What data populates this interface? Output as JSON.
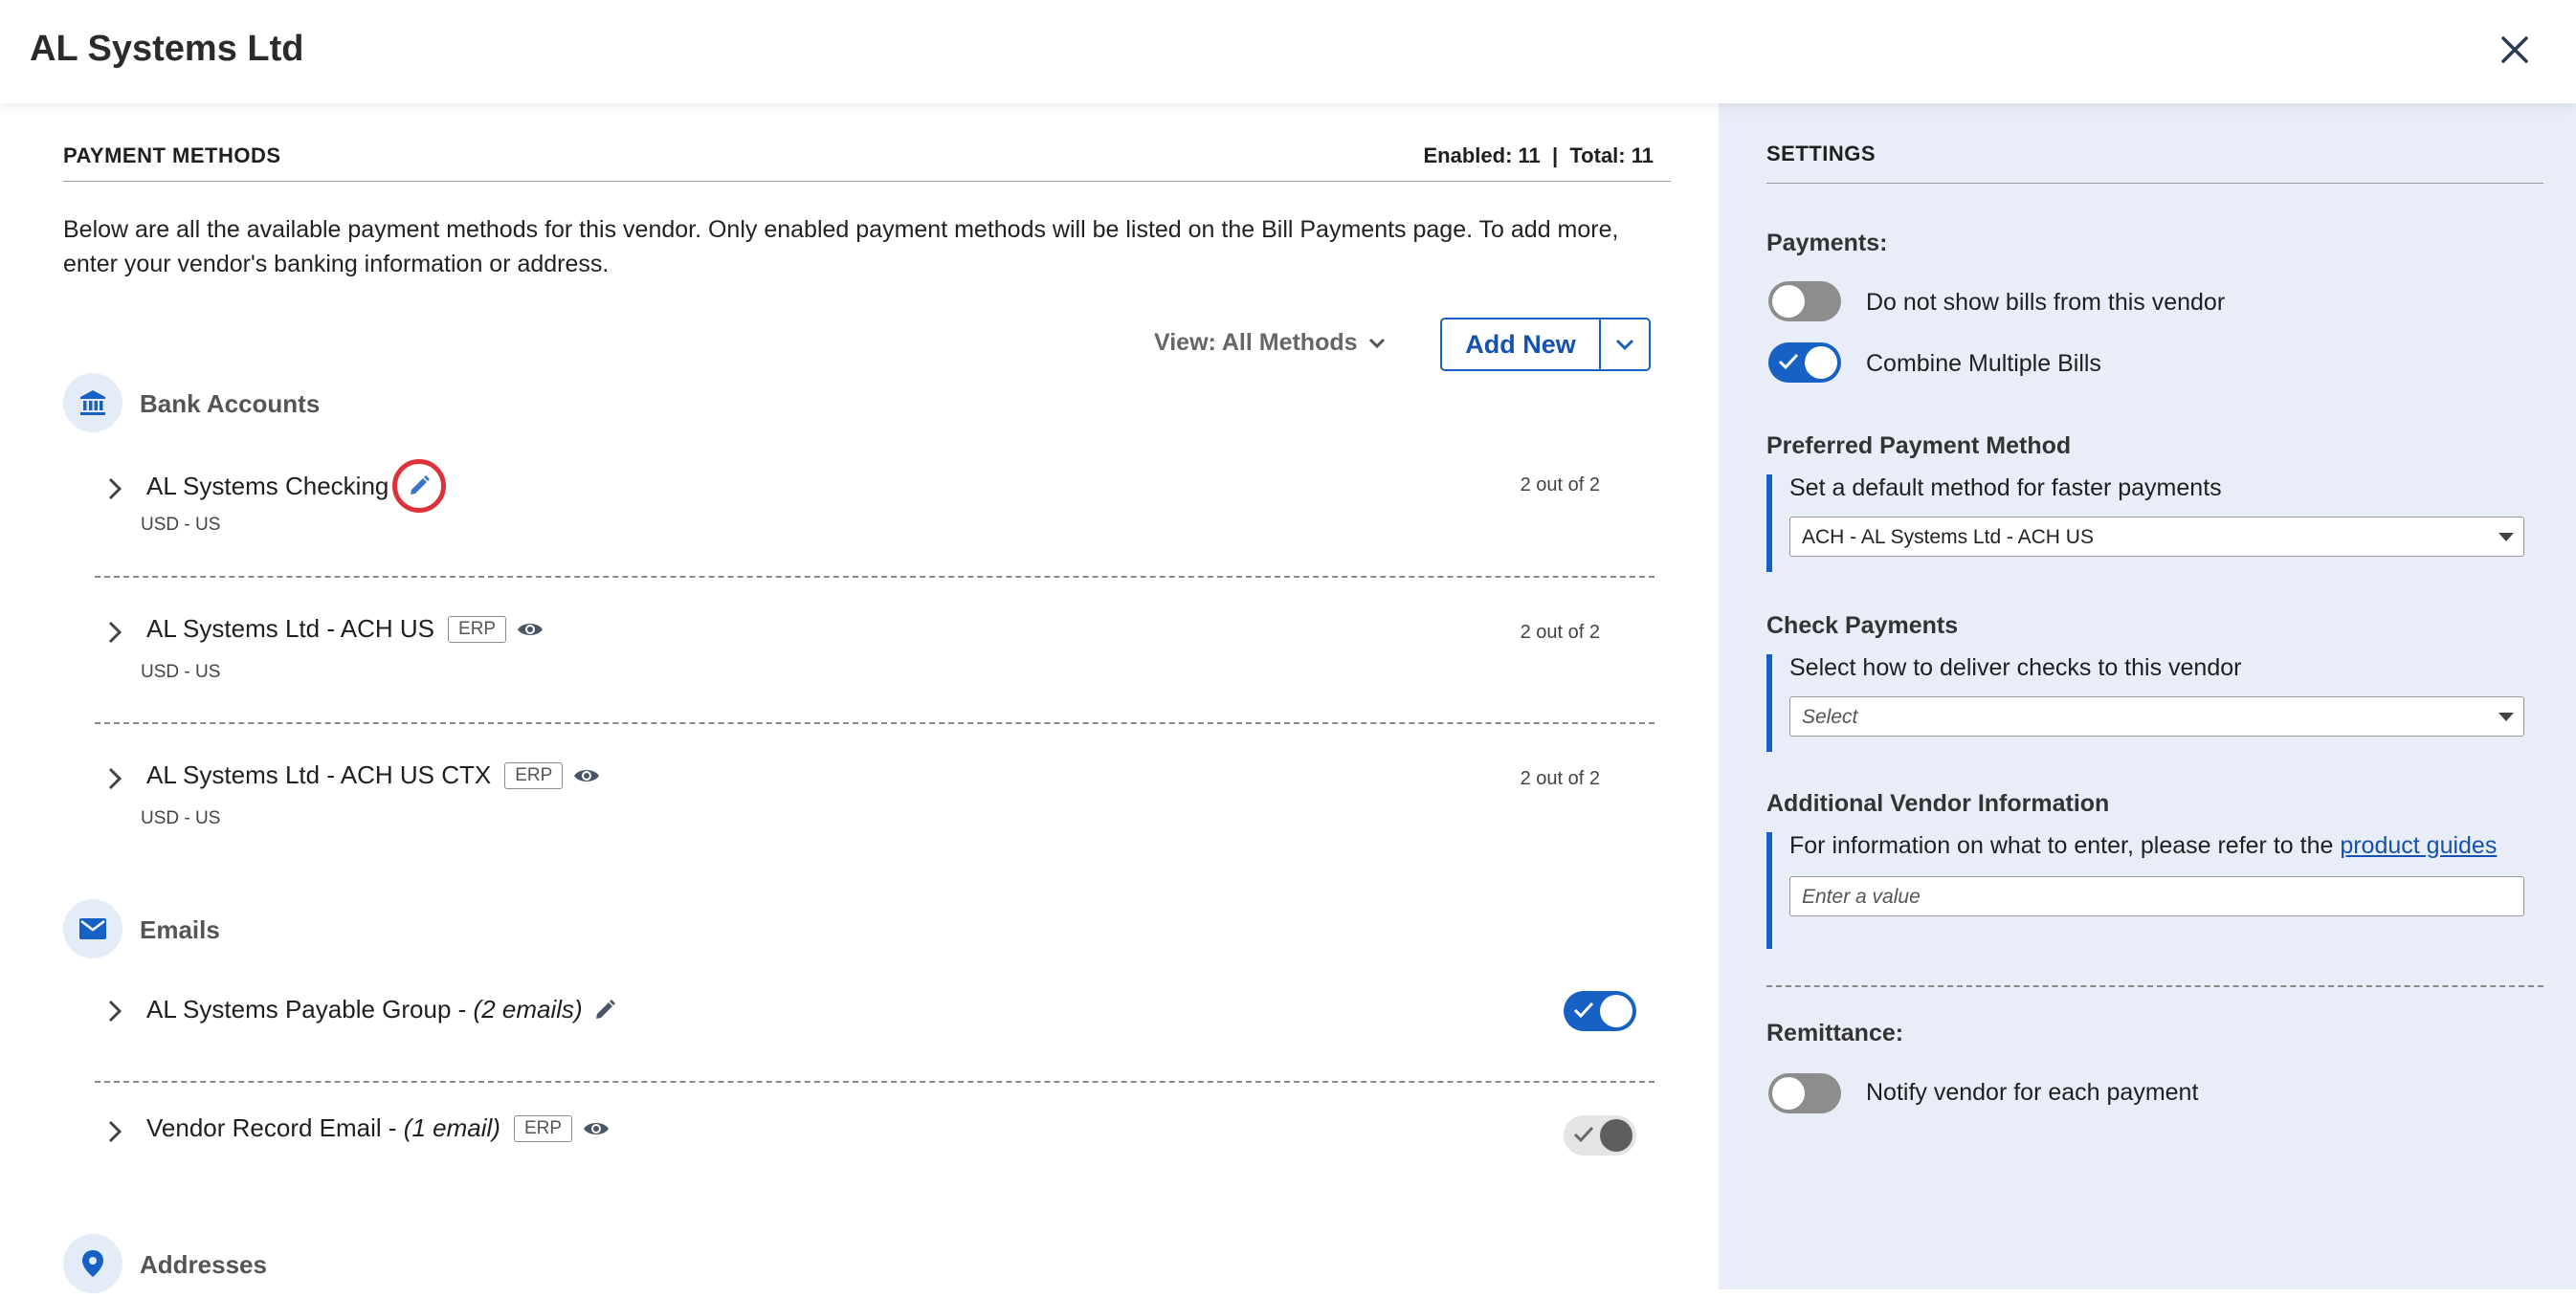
{
  "header": {
    "title": "AL Systems Ltd"
  },
  "payment_methods": {
    "title": "PAYMENT METHODS",
    "counts": "Enabled: 11  |  Total: 11",
    "intro": "Below are all the available payment methods for this vendor. Only enabled payment methods will be listed on the Bill Payments page. To add more, enter your vendor's banking information or address.",
    "view_label": "View: All Methods",
    "add_new_label": "Add New",
    "bank_accounts": {
      "label": "Bank Accounts",
      "items": [
        {
          "name": "AL Systems Checking",
          "sub": "USD - US",
          "count": "2 out of 2"
        },
        {
          "name": "AL Systems Ltd - ACH US",
          "erp": "ERP",
          "sub": "USD - US",
          "count": "2 out of 2"
        },
        {
          "name": "AL Systems Ltd - ACH US CTX",
          "erp": "ERP",
          "sub": "USD - US",
          "count": "2 out of 2"
        }
      ]
    },
    "emails": {
      "label": "Emails",
      "items": [
        {
          "name": "AL Systems Payable Group - ",
          "count_text": "(2 emails)",
          "enabled": true
        },
        {
          "name": "Vendor Record Email - ",
          "count_text": "(1 email)",
          "erp": "ERP",
          "enabled": true
        }
      ]
    },
    "addresses": {
      "label": "Addresses"
    }
  },
  "settings": {
    "title": "SETTINGS",
    "payments_label": "Payments:",
    "do_not_show_label": "Do not show bills from this vendor",
    "do_not_show_enabled": false,
    "combine_label": "Combine Multiple Bills",
    "combine_enabled": true,
    "preferred": {
      "label": "Preferred Payment Method",
      "help": "Set a default method for faster payments",
      "value": "ACH - AL Systems Ltd - ACH US"
    },
    "check": {
      "label": "Check Payments",
      "help": "Select how to deliver checks to this vendor",
      "placeholder": "Select"
    },
    "additional": {
      "label": "Additional Vendor Information",
      "help": "For information on what to enter, please refer to the ",
      "link": "product guides",
      "placeholder": "Enter a value"
    },
    "remittance_label": "Remittance:",
    "notify_label": "Notify vendor for each payment",
    "notify_enabled": false
  },
  "colors": {
    "accent": "#1761c4",
    "highlight": "#e0313a",
    "settings_bg": "#e9edf8"
  }
}
